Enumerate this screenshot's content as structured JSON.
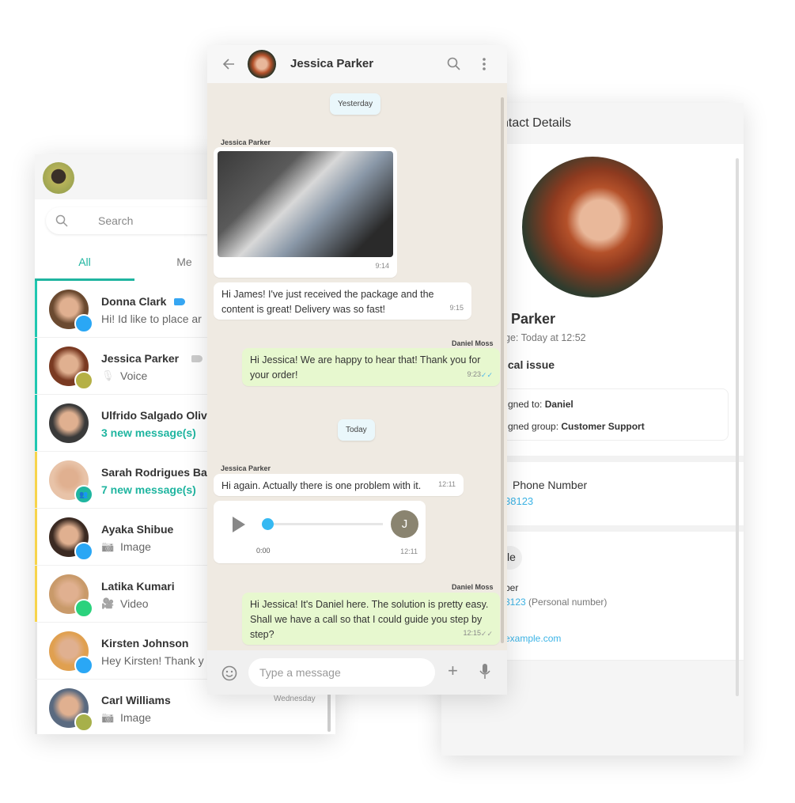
{
  "chat_list": {
    "search_placeholder": "Search",
    "tabs": [
      {
        "label": "All",
        "active": true
      },
      {
        "label": "Me",
        "active": false
      }
    ],
    "accent": "#1fb5a0",
    "items": [
      {
        "name": "Donna Clark",
        "preview": "Hi! Id like to place ar",
        "badge": "R",
        "badge_color": "#2aa7f5",
        "bar_color": "#1fc7b0",
        "tag": "blue-label-icon"
      },
      {
        "name": "Jessica Parker",
        "preview": "Voice",
        "preview_icon": "microphone-icon",
        "badge": "D",
        "badge_color": "#b5b046",
        "bar_color": "#1fc7b0",
        "tag": "gray-label-icon"
      },
      {
        "name": "Ulfrido Salgado Oliv",
        "preview": "3 new message(s)",
        "new": true,
        "bar_color": "#1fc7b0"
      },
      {
        "name": "Sarah Rodrigues Ba",
        "preview": "7 new message(s)",
        "new": true,
        "badge": "group-icon",
        "badge_color": "#1fb5a0",
        "bar_color": "#f7d44c"
      },
      {
        "name": "Ayaka Shibue",
        "preview": "Image",
        "preview_icon": "camera-icon",
        "badge": "R",
        "badge_color": "#2aa7f5",
        "bar_color": "#f7d44c"
      },
      {
        "name": "Latika Kumari",
        "preview": "Video",
        "preview_icon": "video-icon",
        "badge": "C",
        "badge_color": "#2bd27d",
        "bar_color": "#f7d44c"
      },
      {
        "name": "Kirsten Johnson",
        "preview": "Hey Kirsten! Thank y",
        "badge": "R",
        "badge_color": "#2aa7f5",
        "bar_color": "#e6e6e6"
      },
      {
        "name": "Carl Williams",
        "preview": "Image",
        "preview_icon": "camera-icon",
        "badge": "K",
        "badge_color": "#a7b04a",
        "bar_color": "#e6e6e6",
        "time": "Wednesday"
      }
    ]
  },
  "chat": {
    "contact_name": "Jessica Parker",
    "day1": "Yesterday",
    "day2": "Today",
    "messages": [
      {
        "sender": "Jessica Parker",
        "type": "image",
        "time": "9:14"
      },
      {
        "text": "Hi James! I've just received the package and the content is great! Delivery was so fast!",
        "time": "9:15"
      },
      {
        "sender": "Daniel Moss",
        "text": "Hi Jessica! We are happy to hear that! Thank you for your order!",
        "time": "9:23",
        "read": true
      },
      {
        "sender": "Jessica Parker",
        "text": "Hi again. Actually there is one problem with it.",
        "time": "12:11"
      },
      {
        "type": "voice",
        "duration": "0:00",
        "avatar_letter": "J",
        "time": "12:11",
        "progress": 0
      },
      {
        "sender": "Daniel Moss",
        "text": "Hi Jessica! It's Daniel here. The solution is pretty easy. Shall we have a call so that I could guide you step by step?",
        "time": "12:15",
        "read": false
      }
    ],
    "input_placeholder": "Type a message"
  },
  "contact": {
    "header": "ntact Details",
    "name": "Parker",
    "last_message": "ge: Today at 12:52",
    "topic": "ical issue",
    "assigned_to_label": "gned to: ",
    "assigned_to": "Daniel",
    "assigned_group_label": "gned group: ",
    "assigned_group": "Customer Support",
    "phone_title": "Phone Number",
    "phone_value": "38123",
    "section_title": "le",
    "number_label": "ber",
    "number_value": "3123",
    "number_note": "(Personal number)",
    "email": "example.com",
    "link_color": "#3cb4e6"
  }
}
